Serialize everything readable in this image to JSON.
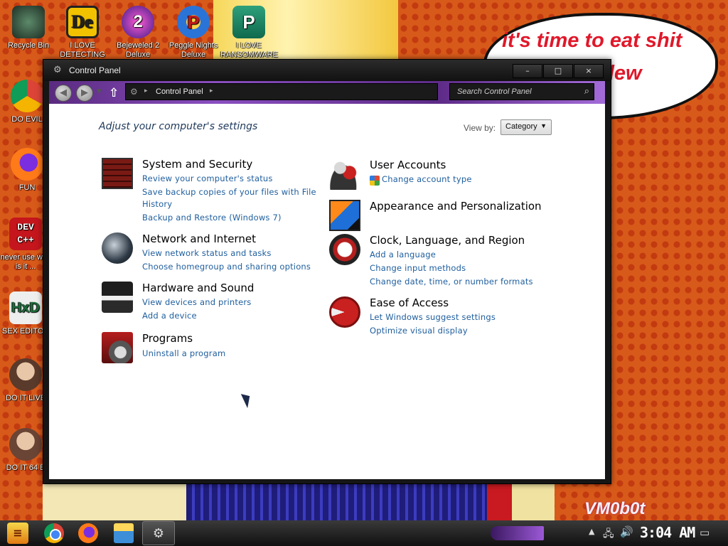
{
  "wallpaper": {
    "speech_text": "it's time to eat shit and chew dew",
    "watermark": "VM0b0t"
  },
  "desktop_icons": [
    {
      "label": "Recycle Bin",
      "icon": "recycle-bin-icon",
      "color": "#3a6a4a"
    },
    {
      "label": "I LOVE DETECTING",
      "icon": "de-app-icon",
      "color": "#f2c200"
    },
    {
      "label": "Bejeweled 2 Deluxe",
      "icon": "bejeweled-icon",
      "color": "#d23a9a"
    },
    {
      "label": "Peggle Nights Deluxe",
      "icon": "peggle-icon",
      "color": "#2a74d8"
    },
    {
      "label": "I LOVE RANSOMWARE",
      "icon": "publisher-icon",
      "color": "#1b8f6a"
    },
    {
      "label": "DO EVIL",
      "icon": "chrome-icon",
      "color": "#4285f4"
    },
    {
      "label": "FUN",
      "icon": "firefox-icon",
      "color": "#ff7a18"
    },
    {
      "label": "never use why is it ...",
      "icon": "dev-cpp-icon",
      "color": "#c4161c"
    },
    {
      "label": "SEX EDITOR",
      "icon": "hxd-icon",
      "color": "#e9e9e9"
    },
    {
      "label": "DO IT LIVE",
      "icon": "portrait-icon",
      "color": "#6b4a3a"
    },
    {
      "label": "DO IT 64 B",
      "icon": "portrait-6-icon",
      "color": "#7a5040"
    }
  ],
  "window": {
    "title": "Control Panel",
    "minimize_label": "–",
    "maximize_label": "□",
    "close_label": "×"
  },
  "nav": {
    "breadcrumb": "Control Panel",
    "search_placeholder": "Search Control Panel"
  },
  "content": {
    "heading": "Adjust your computer's settings",
    "view_by_label": "View by:",
    "view_by_value": "Category",
    "categories_left": [
      {
        "title": "System and Security",
        "icon": "system-security-icon",
        "links": [
          "Review your computer's status",
          "Save backup copies of your files with File",
          "History",
          "Backup and Restore (Windows 7)"
        ]
      },
      {
        "title": "Network and Internet",
        "icon": "network-internet-icon",
        "links": [
          "View network status and tasks",
          "Choose homegroup and sharing options"
        ]
      },
      {
        "title": "Hardware and Sound",
        "icon": "hardware-sound-icon",
        "links": [
          "View devices and printers",
          "Add a device"
        ]
      },
      {
        "title": "Programs",
        "icon": "programs-icon",
        "links": [
          "Uninstall a program"
        ]
      }
    ],
    "categories_right": [
      {
        "title": "User Accounts",
        "icon": "user-accounts-icon",
        "links": [
          "Change account type"
        ]
      },
      {
        "title": "Appearance and Personalization",
        "icon": "appearance-icon",
        "links": []
      },
      {
        "title": "Clock, Language, and Region",
        "icon": "clock-region-icon",
        "links": [
          "Add a language",
          "Change input methods",
          "Change date, time, or number formats"
        ]
      },
      {
        "title": "Ease of Access",
        "icon": "ease-of-access-icon",
        "links": [
          "Let Windows suggest settings",
          "Optimize visual display"
        ]
      }
    ]
  },
  "taskbar": {
    "clock": "3:04 AM",
    "apps": [
      "chrome-icon",
      "firefox-icon",
      "file-explorer-icon",
      "control-panel-icon"
    ]
  }
}
